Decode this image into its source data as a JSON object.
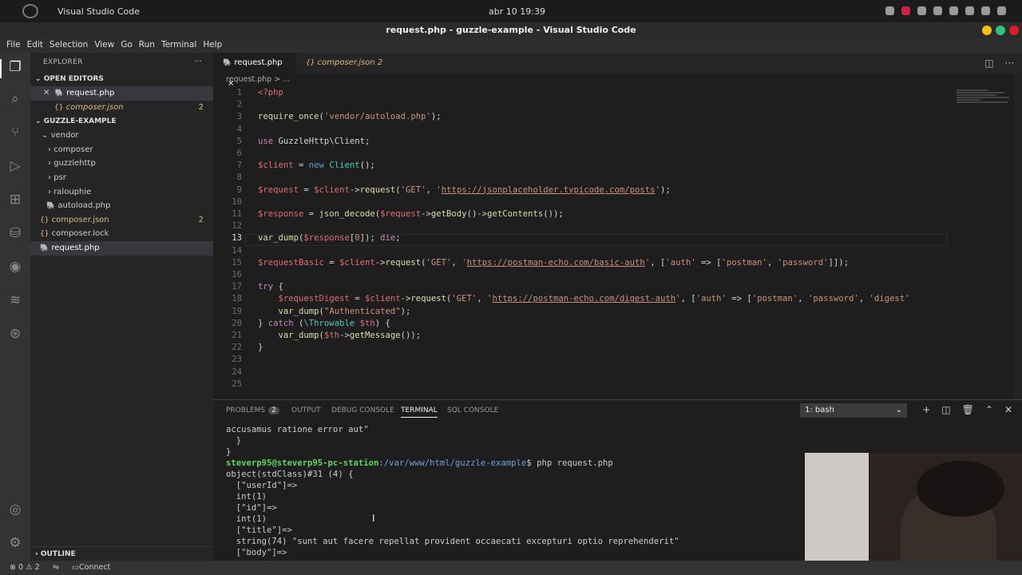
{
  "os": {
    "app_name": "Visual Studio Code",
    "clock": "abr 10  19:39"
  },
  "window": {
    "title": "request.php - guzzle-example - Visual Studio Code"
  },
  "menu": [
    "File",
    "Edit",
    "Selection",
    "View",
    "Go",
    "Run",
    "Terminal",
    "Help"
  ],
  "activity_icons": [
    "explorer-icon",
    "search-icon",
    "source-control-icon",
    "run-debug-icon",
    "extensions-icon",
    "database-icon",
    "spotify-icon",
    "docker-icon",
    "git-graph-icon",
    "account-icon",
    "settings-gear-icon"
  ],
  "sidebar": {
    "header": "EXPLORER",
    "open_editors_title": "OPEN EDITORS",
    "open_editors": [
      {
        "name": "request.php",
        "badge": ""
      },
      {
        "name": "composer.json",
        "badge": "2"
      }
    ],
    "project_title": "GUZZLE-EXAMPLE",
    "tree": [
      {
        "name": "vendor",
        "badge": ""
      },
      {
        "name": "composer",
        "badge": ""
      },
      {
        "name": "guzzlehttp",
        "badge": ""
      },
      {
        "name": "psr",
        "badge": ""
      },
      {
        "name": "ralouphie",
        "badge": ""
      },
      {
        "name": "autoload.php",
        "badge": ""
      },
      {
        "name": "composer.json",
        "badge": "2"
      },
      {
        "name": "composer.lock",
        "badge": ""
      },
      {
        "name": "request.php",
        "badge": ""
      }
    ],
    "outline_title": "OUTLINE"
  },
  "editor": {
    "tabs": [
      {
        "label": "request.php",
        "close": "×"
      },
      {
        "label": "composer.json 2"
      }
    ],
    "breadcrumb": "request.php > ...",
    "line_numbers": [
      "1",
      "2",
      "3",
      "4",
      "5",
      "6",
      "7",
      "8",
      "9",
      "10",
      "11",
      "12",
      "13",
      "14",
      "15",
      "16",
      "17",
      "18",
      "19",
      "20",
      "21",
      "22",
      "23",
      "24",
      "25"
    ],
    "current_line": "13",
    "code": {
      "l1": "<?php",
      "l3_fn": "require_once",
      "l3_str": "'vendor/autoload.php'",
      "l5_kw": "use",
      "l5_ns": "GuzzleHttp\\Client",
      "l7_var": "$client",
      "l7_kw": "new",
      "l7_cls": "Client",
      "l9_var": "$request",
      "l9_var2": "$client",
      "l9_fn": "request",
      "l9_str": "'GET'",
      "l9_url": "https://jsonplaceholder.typicode.com/posts",
      "l11_var": "$response",
      "l11_fn": "json_decode",
      "l11_var2": "$request",
      "l11_fn2": "getBody",
      "l11_fn3": "getContents",
      "l13_fn": "var_dump",
      "l13_var": "$response",
      "l13_idx": "0",
      "l13_kw": "die",
      "l15_var": "$requestBasic",
      "l15_var2": "$client",
      "l15_fn": "request",
      "l15_str": "'GET'",
      "l15_url": "https://postman-echo.com/basic-auth",
      "l15_s1": "'auth'",
      "l15_s2": "'postman'",
      "l15_s3": "'password'",
      "l17_kw": "try",
      "l18_var": "$requestDigest",
      "l18_var2": "$client",
      "l18_fn": "request",
      "l18_str": "'GET'",
      "l18_url": "https://postman-echo.com/digest-auth",
      "l18_s1": "'auth'",
      "l18_s2": "'postman'",
      "l18_s3": "'password'",
      "l18_s4": "'digest'",
      "l19_fn": "var_dump",
      "l19_str": "\"Authenticated\"",
      "l20_kw": "catch",
      "l20_cls": "\\Throwable",
      "l20_var": "$th",
      "l21_fn": "var_dump",
      "l21_var": "$th",
      "l21_fn2": "getMessage"
    }
  },
  "panel": {
    "tabs": [
      {
        "label": "PROBLEMS",
        "badge": "2"
      },
      {
        "label": "OUTPUT"
      },
      {
        "label": "DEBUG CONSOLE"
      },
      {
        "label": "TERMINAL"
      },
      {
        "label": "SQL CONSOLE"
      }
    ],
    "terminal_select": "1: bash",
    "terminal": {
      "t1": "accusamus ratione error aut\"",
      "t2": "  }",
      "t3": "}",
      "prompt_user": "steverp95@steverp95-pc-station",
      "prompt_path": ":/var/www/html/guzzle-example",
      "prompt_cmd": "$ php request.php",
      "t5": "object(stdClass)#31 (4) {",
      "t6": "  [\"userId\"]=>",
      "t7": "  int(1)",
      "t8": "  [\"id\"]=>",
      "t9": "  int(1)",
      "t10": "  [\"title\"]=>",
      "t11": "  string(74) \"sunt aut facere repellat provident occaecati excepturi optio reprehenderit\"",
      "t12": "  [\"body\"]=>"
    }
  },
  "statusbar": {
    "errors": "⊗ 0 ⚠ 2",
    "connect": "Connect"
  }
}
